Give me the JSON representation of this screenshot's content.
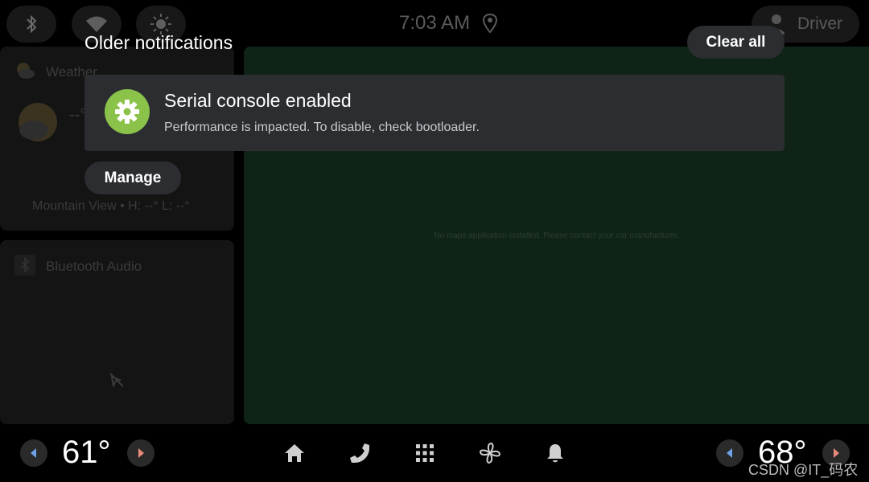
{
  "status_bar": {
    "time": "7:03 AM",
    "driver_label": "Driver",
    "icons": [
      "bluetooth-icon",
      "wifi-icon",
      "brightness-icon",
      "location-icon",
      "person-icon"
    ]
  },
  "weather_card": {
    "title": "Weather",
    "temp": "--°",
    "location_line": "Mountain View • H: --° L: --°"
  },
  "bluetooth_card": {
    "title": "Bluetooth Audio"
  },
  "map": {
    "message": "No maps application installed. Please contact your car manufacturer."
  },
  "notifications": {
    "header": "Older notifications",
    "clear_all_label": "Clear all",
    "items": [
      {
        "title": "Serial console enabled",
        "text": "Performance is impacted. To disable, check bootloader.",
        "icon": "gear-icon",
        "action_label": "Manage"
      }
    ]
  },
  "climate": {
    "left_temp": "61°",
    "right_temp": "68°"
  },
  "watermark": "CSDN @IT_码农",
  "colors": {
    "notif_icon_bg": "#8bc34a",
    "card_bg": "#2b2d31",
    "map_bg": "#0f2417",
    "left_arrow": "#6fa0e8",
    "right_arrow": "#e88a7a"
  }
}
